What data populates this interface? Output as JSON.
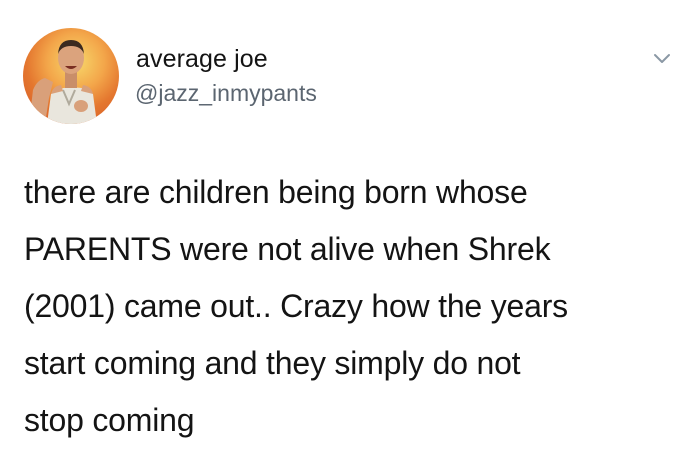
{
  "author": {
    "display_name": "average joe",
    "handle": "@jazz_inmypants",
    "avatar_icon": "profile-photo"
  },
  "menu": {
    "icon": "chevron-down-icon"
  },
  "tweet": {
    "lines": [
      "there are children being born whose",
      "PARENTS were not alive when Shrek",
      "(2001) came out.. Crazy how the years",
      "start coming and they simply do not",
      "stop coming"
    ]
  },
  "colors": {
    "text": "#141414",
    "handle": "#5b6570",
    "background": "#ffffff"
  }
}
